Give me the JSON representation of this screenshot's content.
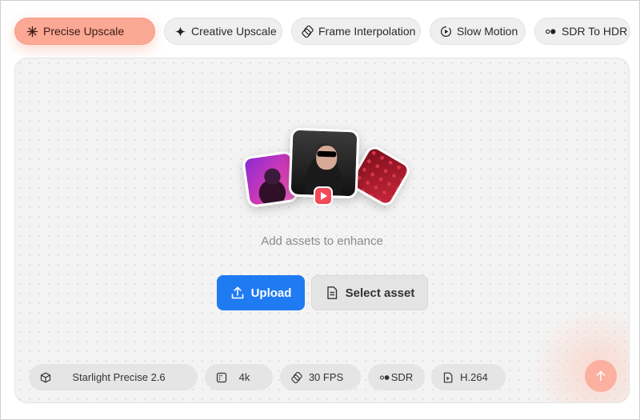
{
  "tabs": [
    {
      "label": "Precise Upscale",
      "icon": "asterisk-icon",
      "active": true
    },
    {
      "label": "Creative Upscale",
      "icon": "sparkle-icon",
      "active": false
    },
    {
      "label": "Frame Interpolation",
      "icon": "frames-icon",
      "active": false
    },
    {
      "label": "Slow Motion",
      "icon": "slow-play-icon",
      "active": false
    },
    {
      "label": "SDR To HDR",
      "icon": "dots-icon",
      "active": false
    }
  ],
  "main": {
    "hint": "Add assets to enhance",
    "upload_label": "Upload",
    "select_label": "Select asset"
  },
  "settings": [
    {
      "label": "Starlight Precise 2.6",
      "icon": "cube-icon"
    },
    {
      "label": "4k",
      "icon": "resolution-icon"
    },
    {
      "label": "30 FPS",
      "icon": "frames-icon"
    },
    {
      "label": "SDR",
      "icon": "dots-icon"
    },
    {
      "label": "H.264",
      "icon": "codec-file-icon"
    }
  ],
  "colors": {
    "accent": "#fba894",
    "primary_button": "#1f7bf2",
    "send_button": "#fbb0a0"
  }
}
